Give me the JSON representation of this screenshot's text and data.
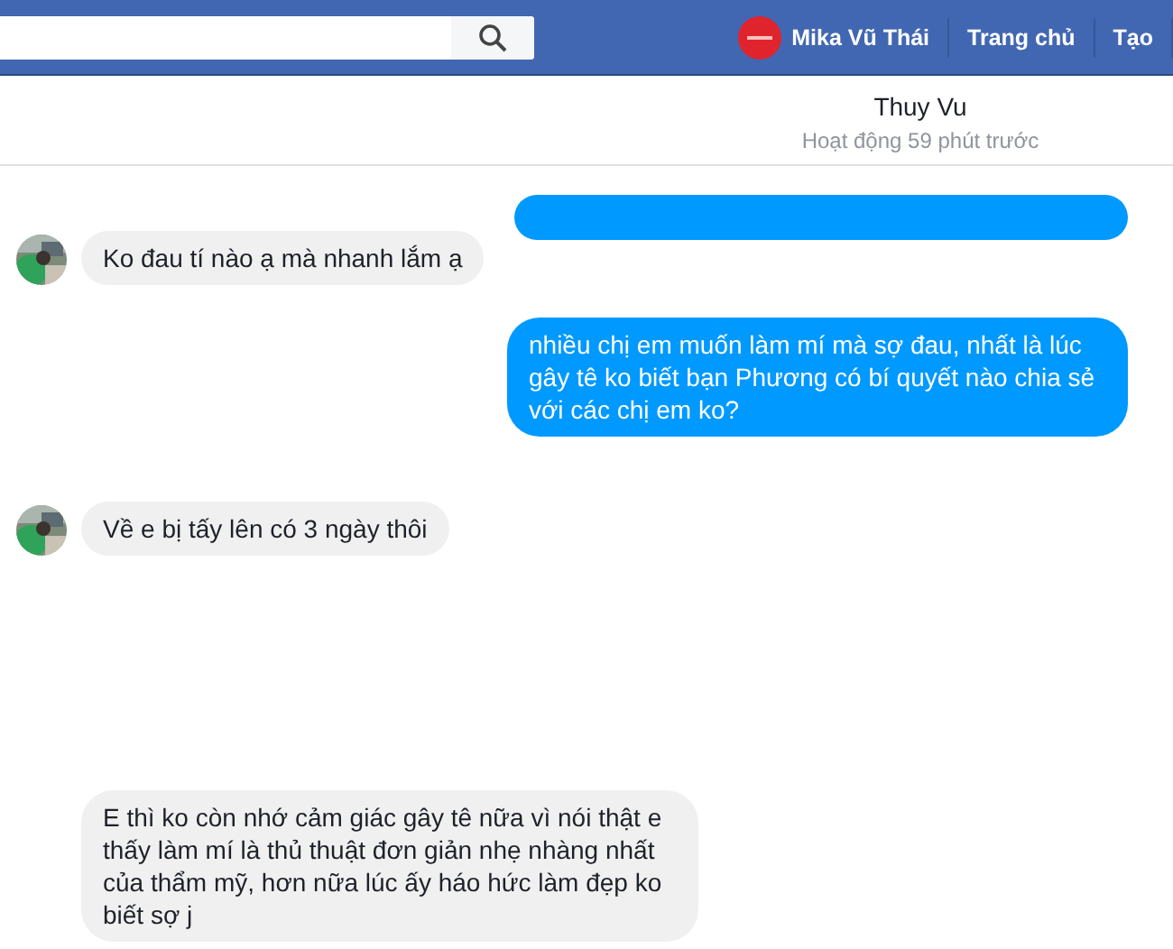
{
  "top_bar": {
    "profile_name": "Mika Vũ Thái",
    "links": [
      "Trang chủ",
      "Tạo"
    ]
  },
  "chat_header": {
    "name": "Thuy Vu",
    "status": "Hoạt động 59 phút trước"
  },
  "messages": [
    {
      "kind": "in",
      "text": "Ko đau tí nào ạ mà nhanh lắm ạ"
    },
    {
      "kind": "out",
      "text": "nhiều chị em muốn làm mí mà sợ đau, nhất là lúc gây tê ko biết bạn Phương có bí quyết nào chia sẻ với các chị em ko?"
    },
    {
      "kind": "in",
      "text": "Về e bị tấy lên có 3 ngày thôi"
    },
    {
      "kind": "in-noavatar",
      "text": "E thì ko còn nhớ cảm giác gây tê nữa vì nói thật e thấy làm mí là thủ thuật đơn giản nhẹ nhàng nhất của thẩm mỹ, hơn nữa lúc ấy háo hức làm đẹp ko biết sợ j"
    }
  ]
}
